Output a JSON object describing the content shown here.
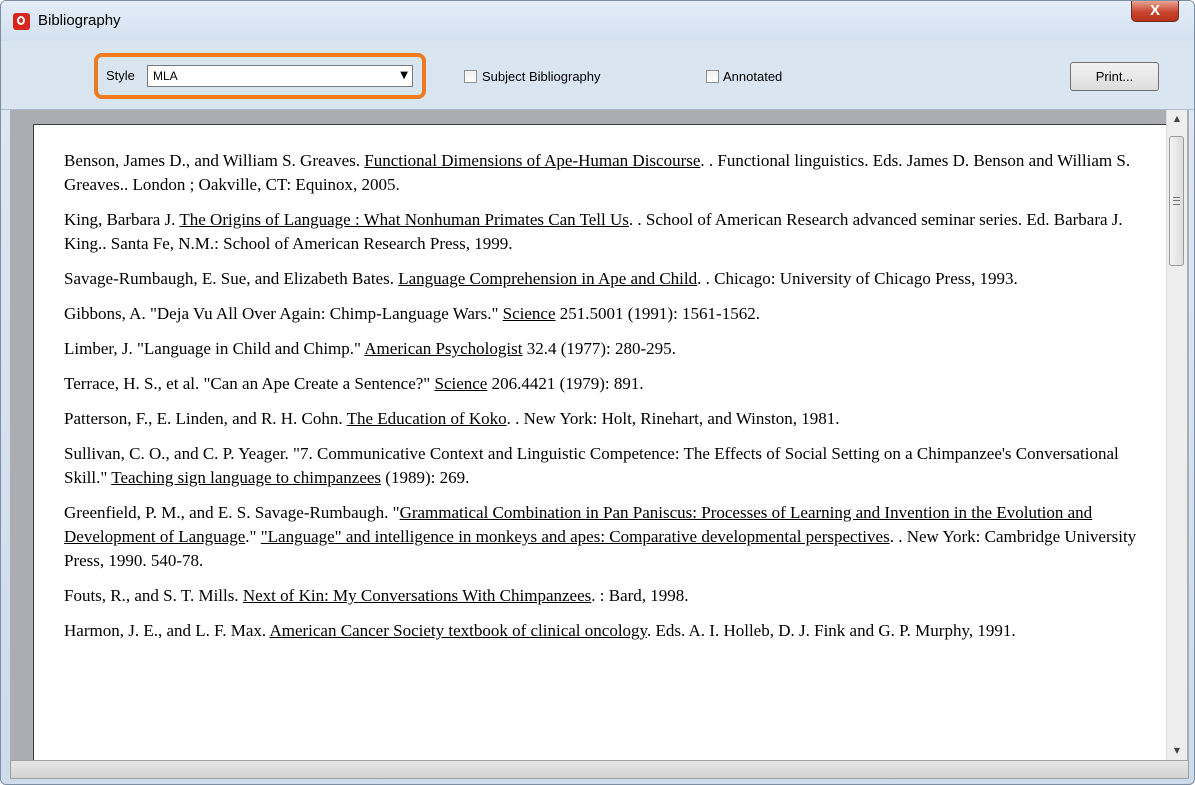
{
  "window": {
    "title": "Bibliography",
    "close_label": "X"
  },
  "toolbar": {
    "style_label": "Style",
    "style_value": "MLA",
    "subject_bibliography_label": "Subject Bibliography",
    "subject_bibliography_checked": false,
    "annotated_label": "Annotated",
    "annotated_checked": false,
    "print_label": "Print..."
  },
  "entries": [
    {
      "p1": "Benson, James D., and William S. Greaves. ",
      "u1": "Functional Dimensions of Ape-Human Discourse",
      "p2": ". . Functional linguistics. Eds. James D. Benson and William S. Greaves.. London ; Oakville, CT: Equinox, 2005."
    },
    {
      "p1": "King, Barbara J. ",
      "u1": "The Origins of Language : What Nonhuman Primates Can Tell Us",
      "p2": ". . School of American Research advanced seminar series. Ed. Barbara J. King.. Santa Fe, N.M.: School of American Research Press, 1999."
    },
    {
      "p1": "Savage-Rumbaugh, E. Sue, and Elizabeth Bates. ",
      "u1": "Language Comprehension in Ape and Child",
      "p2": ". . Chicago: University of Chicago Press, 1993."
    },
    {
      "p1": "Gibbons, A. \"Deja Vu All Over Again: Chimp-Language Wars.\" ",
      "u1": "Science",
      "p2": " 251.5001 (1991): 1561-1562."
    },
    {
      "p1": "Limber, J. \"Language in Child and Chimp.\" ",
      "u1": "American Psychologist",
      "p2": " 32.4 (1977): 280-295."
    },
    {
      "p1": "Terrace, H. S., et al. \"Can an Ape Create a Sentence?\" ",
      "u1": "Science",
      "p2": " 206.4421 (1979): 891."
    },
    {
      "p1": "Patterson, F., E. Linden, and R. H. Cohn. ",
      "u1": "The Education of Koko",
      "p2": ". . New York: Holt, Rinehart, and Winston, 1981."
    },
    {
      "p1": "Sullivan, C. O., and C. P. Yeager. \"7. Communicative Context and Linguistic Competence: The Effects of Social Setting on a Chimpanzee's Conversational Skill.\" ",
      "u1": "Teaching sign language to chimpanzees",
      "p2": " (1989): 269."
    },
    {
      "p1": "Greenfield, P. M., and E. S. Savage-Rumbaugh. \"",
      "u1": "Grammatical Combination in Pan Paniscus: Processes of Learning and Invention in the Evolution and Development of Language",
      "p2": ".\" ",
      "u2": "\"Language\" and intelligence in monkeys and apes: Comparative developmental perspectives",
      "p3": ". . New York: Cambridge University Press, 1990. 540-78."
    },
    {
      "p1": "Fouts, R., and S. T. Mills. ",
      "u1": "Next of Kin: My Conversations With Chimpanzees",
      "p2": ". : Bard, 1998."
    },
    {
      "p1": "Harmon, J. E., and L. F. Max. ",
      "u1": "American Cancer Society textbook of clinical oncology",
      "p2": ". Eds. A. I. Holleb, D. J. Fink and G. P. Murphy, 1991."
    }
  ],
  "colors": {
    "highlight": "#f07a1f",
    "close_button": "#c7452f",
    "toolbar_bg": "#dae5f2"
  },
  "icons": {
    "app": "app-logo-icon",
    "dropdown": "chevron-down-icon",
    "scroll_up": "scroll-up-arrow-icon",
    "scroll_down": "scroll-down-arrow-icon"
  }
}
